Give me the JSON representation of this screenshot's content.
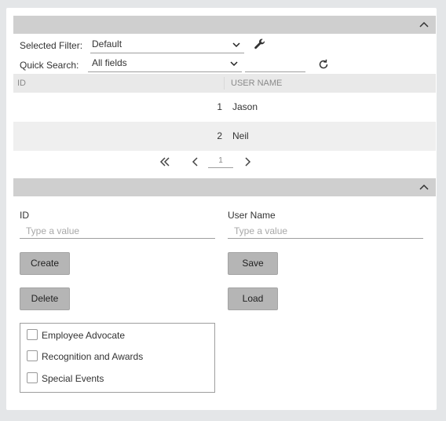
{
  "filter": {
    "selected_label": "Selected Filter:",
    "selected_value": "Default",
    "quick_label": "Quick Search:",
    "quick_value": "All fields"
  },
  "grid": {
    "columns": [
      "ID",
      "USER NAME"
    ],
    "rows": [
      {
        "id": "1",
        "name": "Jason"
      },
      {
        "id": "2",
        "name": "Neil"
      }
    ]
  },
  "pager": {
    "page": "1"
  },
  "form": {
    "id_label": "ID",
    "id_placeholder": "Type a value",
    "username_label": "User Name",
    "username_placeholder": "Type a value",
    "create_label": "Create",
    "save_label": "Save",
    "delete_label": "Delete",
    "load_label": "Load"
  },
  "checklist": [
    {
      "label": "Employee Advocate",
      "checked": false
    },
    {
      "label": "Recognition and Awards",
      "checked": false
    },
    {
      "label": "Special Events",
      "checked": false
    }
  ],
  "icons": {
    "collapse": "chevron-up-icon",
    "dropdown": "chevron-down-icon",
    "settings": "wrench-icon",
    "refresh": "refresh-icon",
    "first": "double-chevron-left-icon",
    "prev": "chevron-left-icon",
    "next": "chevron-right-icon"
  },
  "colors": {
    "header_bar": "#cfcfcf",
    "grid_header": "#e9e9e9",
    "alt_row": "#efefef",
    "button": "#b5b5b5"
  }
}
